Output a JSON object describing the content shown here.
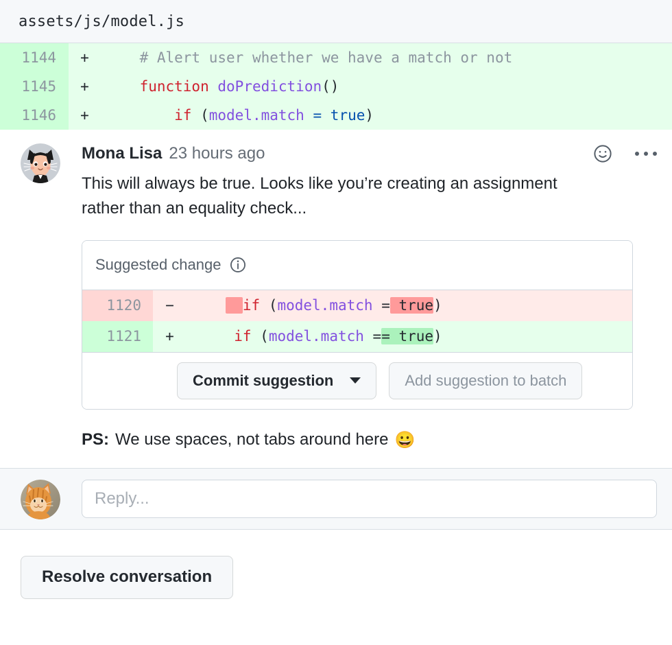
{
  "file": {
    "path": "assets/js/model.js"
  },
  "diff": {
    "rows": [
      {
        "line": "1144",
        "sign": "+",
        "type": "add",
        "tokens": [
          {
            "t": "    ",
            "c": "plain"
          },
          {
            "t": "# Alert user whether we have a match or not",
            "c": "comment"
          }
        ]
      },
      {
        "line": "1145",
        "sign": "+",
        "type": "add",
        "tokens": [
          {
            "t": "    ",
            "c": "plain"
          },
          {
            "t": "function",
            "c": "kw"
          },
          {
            "t": " ",
            "c": "plain"
          },
          {
            "t": "doPrediction",
            "c": "fn"
          },
          {
            "t": "()",
            "c": "plain"
          }
        ]
      },
      {
        "line": "1146",
        "sign": "+",
        "type": "add",
        "tokens": [
          {
            "t": "        ",
            "c": "plain"
          },
          {
            "t": "if",
            "c": "kw"
          },
          {
            "t": " (",
            "c": "plain"
          },
          {
            "t": "model.match",
            "c": "var"
          },
          {
            "t": " ",
            "c": "plain"
          },
          {
            "t": "=",
            "c": "op"
          },
          {
            "t": " ",
            "c": "plain"
          },
          {
            "t": "true",
            "c": "const"
          },
          {
            "t": ")",
            "c": "plain"
          }
        ]
      }
    ]
  },
  "comment": {
    "author": "Mona Lisa",
    "timestamp": "23 hours ago",
    "body": "This will always be true. Looks like you’re creating an assignment rather than an equality check...",
    "reaction_icon": "smiley-icon",
    "menu_icon": "kebab-menu-icon",
    "ps": {
      "label": "PS:",
      "text": "We use spaces, not tabs around here",
      "emoji": "😀"
    }
  },
  "suggestion": {
    "header_label": "Suggested change",
    "info_icon": "info-icon",
    "rows": [
      {
        "line": "1120",
        "sign": "−",
        "type": "del",
        "tokens": [
          {
            "t": "    ",
            "c": "plain"
          },
          {
            "t": "  ",
            "c": "plain",
            "hl": "del"
          },
          {
            "t": "if",
            "c": "kw"
          },
          {
            "t": " (",
            "c": "plain"
          },
          {
            "t": "model.match",
            "c": "var"
          },
          {
            "t": " =",
            "c": "plain"
          },
          {
            "t": " true",
            "c": "plain",
            "hl": "del"
          },
          {
            "t": ")",
            "c": "plain"
          }
        ]
      },
      {
        "line": "1121",
        "sign": "+",
        "type": "add",
        "tokens": [
          {
            "t": "     ",
            "c": "plain"
          },
          {
            "t": "if",
            "c": "kw"
          },
          {
            "t": " (",
            "c": "plain"
          },
          {
            "t": "model.match",
            "c": "var"
          },
          {
            "t": " =",
            "c": "plain"
          },
          {
            "t": "= true",
            "c": "plain",
            "hl": "add"
          },
          {
            "t": ")",
            "c": "plain"
          }
        ]
      }
    ],
    "commit_button": "Commit suggestion",
    "batch_button": "Add suggestion to batch"
  },
  "reply": {
    "placeholder": "Reply...",
    "avatar": "cat-avatar"
  },
  "resolve_button": "Resolve conversation",
  "colors": {
    "add_bg": "#e6ffec",
    "add_gutter": "#ccffd8",
    "del_bg": "#ffebe9",
    "del_gutter": "#ffd7d5",
    "hl_add": "#abf2bc",
    "hl_del": "#ff9a9a",
    "header_bg": "#f6f8fa",
    "border": "#d0d7de",
    "keyword": "#cf222e",
    "identifier": "#8250df",
    "constant": "#0550ae",
    "comment": "#8c959f"
  }
}
